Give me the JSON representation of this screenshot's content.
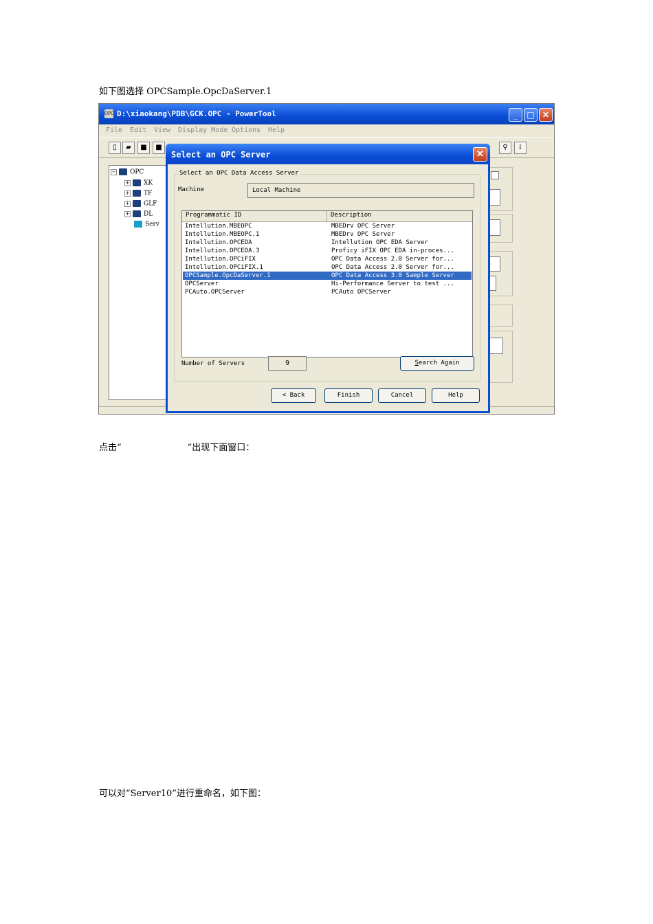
{
  "doc": {
    "para1": "如下图选择 OPCSample.OpcDaServer.1",
    "para2_open": "点击“",
    "para2_close": "”出现下面窗口：",
    "para3": "可以对“Server10”进行重命名，如下图："
  },
  "main_window": {
    "title": "D:\\xiaokang\\PDB\\GCK.OPC - PowerTool",
    "menu": [
      "File",
      "Edit",
      "View",
      "Display Mode",
      "Options",
      "Help"
    ],
    "tree": {
      "root": "OPC",
      "nodes": [
        "XK",
        "TF",
        "GLF",
        "DL"
      ],
      "selected": "Serv"
    }
  },
  "dialog": {
    "title": "Select an OPC Server",
    "group_label": "Select an OPC Data Access Server",
    "machine_label": "Machine",
    "machine_value": "Local Machine",
    "columns": [
      "Programmatic ID",
      "Description"
    ],
    "rows": [
      {
        "id": "Intellution.MBEOPC",
        "desc": "MBEDrv OPC Server"
      },
      {
        "id": "Intellution.MBEOPC.1",
        "desc": "MBEDrv OPC Server"
      },
      {
        "id": "Intellution.OPCEDA",
        "desc": "Intellution OPC EDA Server"
      },
      {
        "id": "Intellution.OPCEDA.3",
        "desc": "Proficy iFIX OPC EDA in-proces..."
      },
      {
        "id": "Intellution.OPCiFIX",
        "desc": "OPC Data Access 2.0 Server for..."
      },
      {
        "id": "Intellution.OPCiFIX.1",
        "desc": "OPC Data Access 2.0 Server for..."
      },
      {
        "id": "OPCSample.OpcDaServer.1",
        "desc": "OPC Data Access 3.0 Sample Server",
        "selected": true
      },
      {
        "id": "OPCServer",
        "desc": "Hi-Performance Server to test ..."
      },
      {
        "id": "PCAuto.OPCServer",
        "desc": "PCAuto OPCServer"
      }
    ],
    "count_label": "Number of Servers",
    "count_value": "9",
    "search_again": "Search Again",
    "back": "< Back",
    "finish": "Finish",
    "cancel": "Cancel",
    "help": "Help"
  }
}
